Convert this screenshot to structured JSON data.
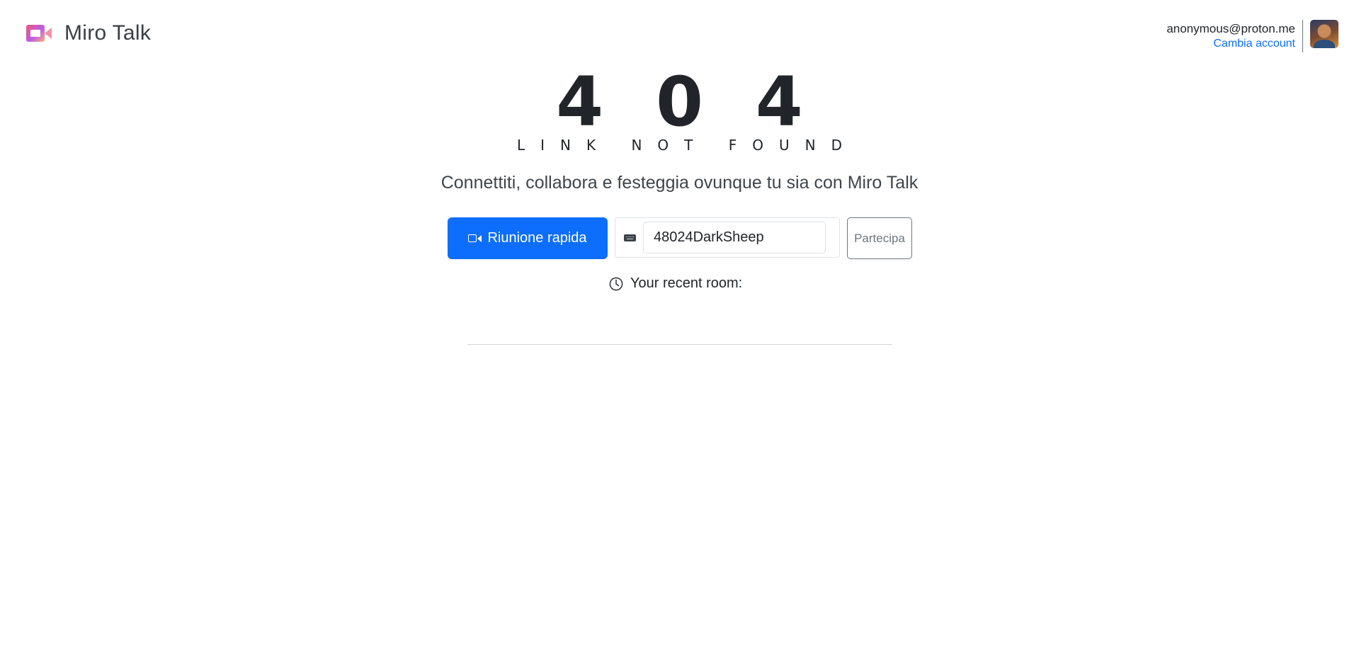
{
  "header": {
    "brand_title": "Miro Talk",
    "account_email": "anonymous@proton.me",
    "switch_account_label": "Cambia account"
  },
  "hero": {
    "error_code": "404",
    "error_message": "LINK NOT FOUND",
    "tagline": "Connettiti, collabora e festeggia ovunque tu sia con Miro Talk"
  },
  "actions": {
    "quick_meeting_label": "Riunione rapida",
    "room_name_value": "48024DarkSheep",
    "join_label": "Partecipa"
  },
  "recent": {
    "label": "Your recent room:"
  },
  "colors": {
    "primary": "#0d6efd",
    "text": "#212529",
    "muted": "#6c757d"
  },
  "icons": [
    "miro-talk-logo-icon",
    "video-camera-icon",
    "keyboard-icon",
    "clock-icon"
  ]
}
